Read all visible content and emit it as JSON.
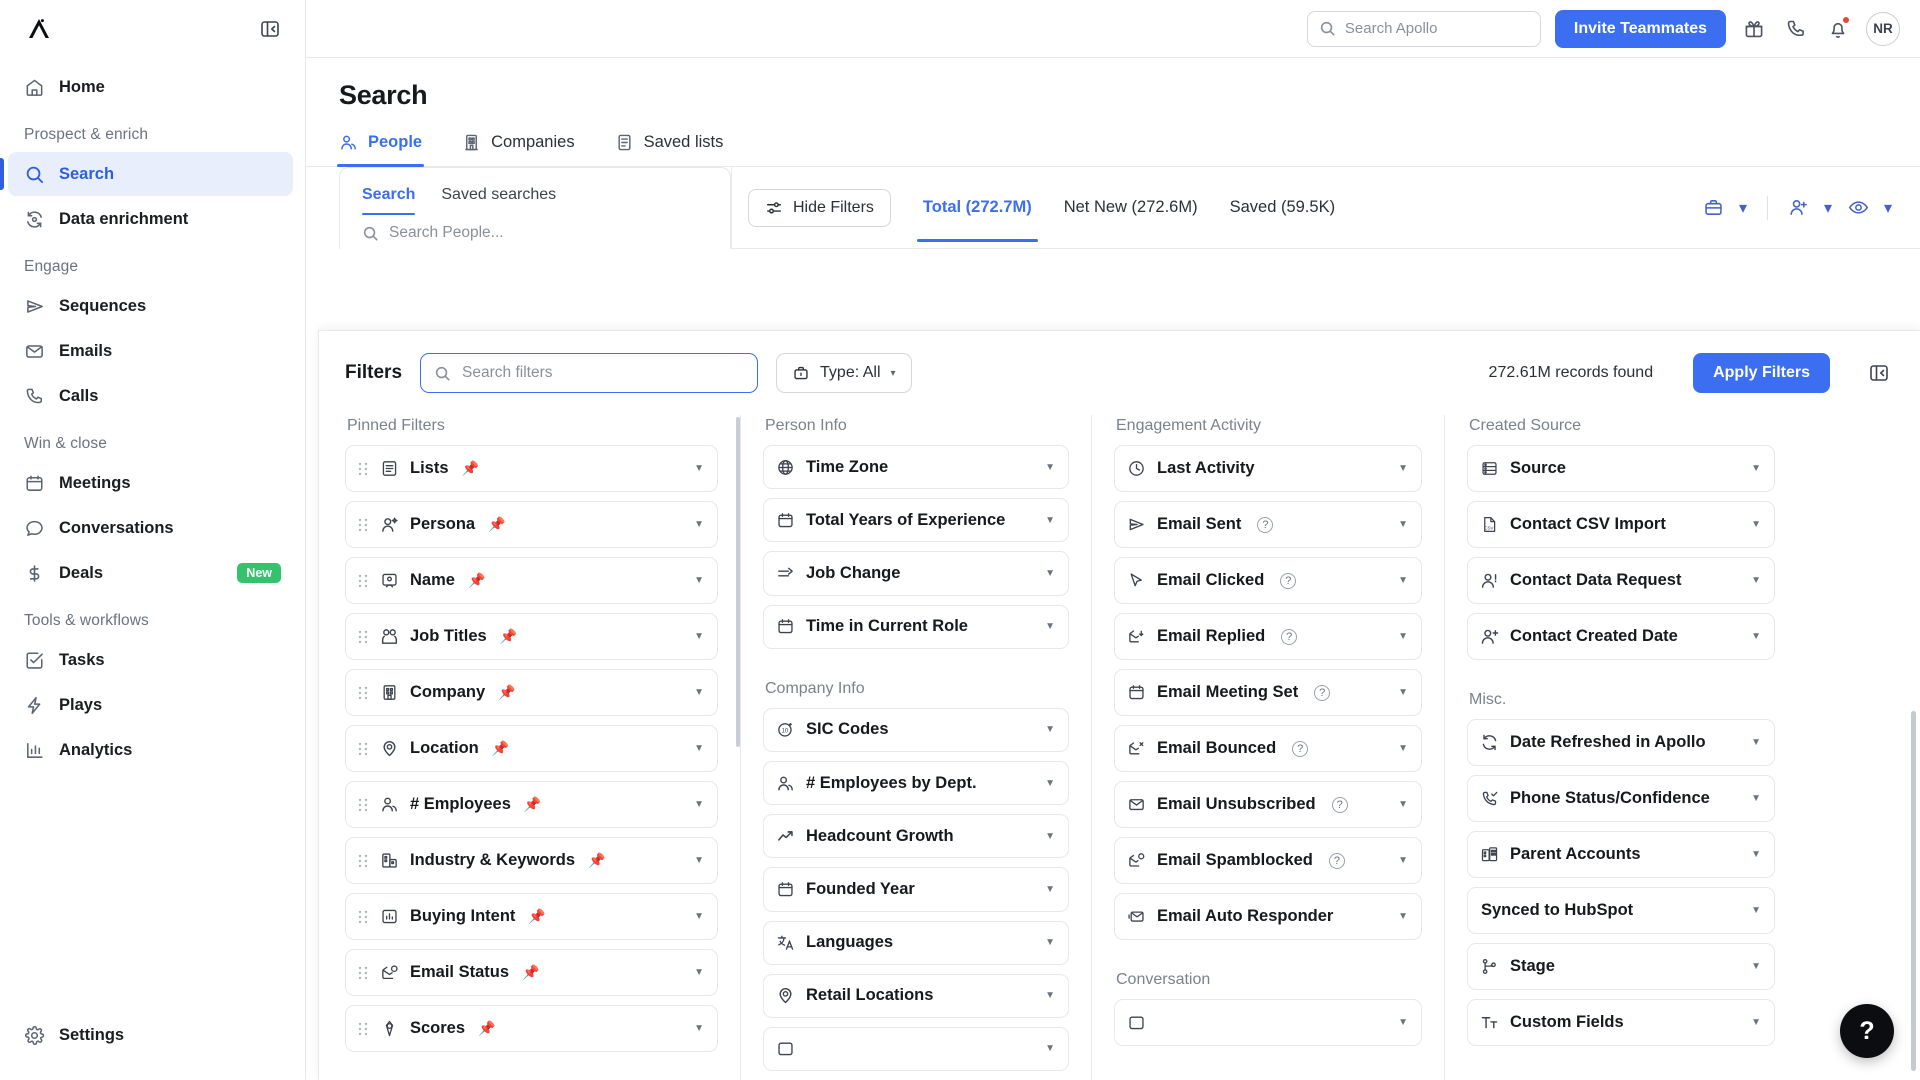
{
  "app": {
    "logo_name": "apollo-logo",
    "user_initials": "NR"
  },
  "topbar": {
    "search_placeholder": "Search Apollo",
    "search_value": "",
    "invite_label": "Invite Teammates",
    "icons": [
      "gift-icon",
      "phone-icon",
      "bell-icon"
    ]
  },
  "sidebar": {
    "home": {
      "label": "Home",
      "icon": "home-icon"
    },
    "groups": [
      {
        "label": "Prospect & enrich",
        "items": [
          {
            "label": "Search",
            "icon": "search-icon",
            "active": true
          },
          {
            "label": "Data enrichment",
            "icon": "refresh-data-icon",
            "active": false
          }
        ]
      },
      {
        "label": "Engage",
        "items": [
          {
            "label": "Sequences",
            "icon": "send-icon",
            "active": false
          },
          {
            "label": "Emails",
            "icon": "envelope-icon",
            "active": false
          },
          {
            "label": "Calls",
            "icon": "phone-icon",
            "active": false
          }
        ]
      },
      {
        "label": "Win & close",
        "items": [
          {
            "label": "Meetings",
            "icon": "calendar-icon",
            "active": false
          },
          {
            "label": "Conversations",
            "icon": "chat-bubble-icon",
            "active": false
          },
          {
            "label": "Deals",
            "icon": "dollar-icon",
            "active": false,
            "badge": "New"
          }
        ]
      },
      {
        "label": "Tools & workflows",
        "items": [
          {
            "label": "Tasks",
            "icon": "checkbox-icon",
            "active": false
          },
          {
            "label": "Plays",
            "icon": "lightning-icon",
            "active": false
          },
          {
            "label": "Analytics",
            "icon": "bar-chart-icon",
            "active": false
          }
        ]
      }
    ],
    "settings": {
      "label": "Settings",
      "icon": "gear-icon"
    }
  },
  "page": {
    "title": "Search",
    "tabs": [
      {
        "label": "People",
        "icon": "people-icon",
        "active": true
      },
      {
        "label": "Companies",
        "icon": "building-icon",
        "active": false
      },
      {
        "label": "Saved lists",
        "icon": "list-icon",
        "active": false
      }
    ]
  },
  "search_panel": {
    "tabs": [
      {
        "label": "Search",
        "active": true
      },
      {
        "label": "Saved searches",
        "active": false
      }
    ],
    "input_placeholder": "Search People...",
    "input_value": ""
  },
  "filter_bar": {
    "hide_filters_label": "Hide Filters",
    "count_tabs": [
      {
        "label": "Total (272.7M)",
        "active": true
      },
      {
        "label": "Net New (272.6M)",
        "active": false
      },
      {
        "label": "Saved (59.5K)",
        "active": false
      }
    ],
    "action_icons": [
      "briefcase-icon",
      "add-person-icon",
      "eye-icon"
    ]
  },
  "filters": {
    "title": "Filters",
    "search_placeholder": "Search filters",
    "search_value": "",
    "type_label": "Type: All",
    "records_found": "272.61M records found",
    "apply_label": "Apply Filters",
    "collapse_icon": "collapse-panel-icon",
    "columns": [
      {
        "id": "pinned",
        "groups": [
          {
            "label": "Pinned Filters",
            "items": [
              {
                "label": "Lists",
                "icon": "list-icon",
                "pinned": true,
                "drag": true
              },
              {
                "label": "Persona",
                "icon": "persona-icon",
                "pinned": true,
                "drag": true
              },
              {
                "label": "Name",
                "icon": "name-card-icon",
                "pinned": true,
                "drag": true
              },
              {
                "label": "Job Titles",
                "icon": "job-title-icon",
                "pinned": true,
                "drag": true
              },
              {
                "label": "Company",
                "icon": "building-icon",
                "pinned": true,
                "drag": true
              },
              {
                "label": "Location",
                "icon": "location-pin-icon",
                "pinned": true,
                "drag": true
              },
              {
                "label": "# Employees",
                "icon": "people-icon",
                "pinned": true,
                "drag": true
              },
              {
                "label": "Industry & Keywords",
                "icon": "industry-icon",
                "pinned": true,
                "drag": true
              },
              {
                "label": "Buying Intent",
                "icon": "bar-chart-icon",
                "pinned": true,
                "drag": true
              },
              {
                "label": "Email Status",
                "icon": "email-status-icon",
                "pinned": true,
                "drag": true
              },
              {
                "label": "Scores",
                "icon": "score-icon",
                "pinned": true,
                "drag": true
              }
            ]
          }
        ]
      },
      {
        "id": "person-company",
        "groups": [
          {
            "label": "Person Info",
            "items": [
              {
                "label": "Time Zone",
                "icon": "globe-icon"
              },
              {
                "label": "Total Years of Experience",
                "icon": "calendar-icon"
              },
              {
                "label": "Job Change",
                "icon": "arrow-change-icon"
              },
              {
                "label": "Time in Current Role",
                "icon": "calendar-icon"
              }
            ]
          },
          {
            "label": "Company Info",
            "items": [
              {
                "label": "SIC Codes",
                "icon": "sic-code-icon"
              },
              {
                "label": "# Employees by Dept.",
                "icon": "people-icon"
              },
              {
                "label": "Headcount Growth",
                "icon": "trend-up-icon"
              },
              {
                "label": "Founded Year",
                "icon": "calendar-icon"
              },
              {
                "label": "Languages",
                "icon": "translate-icon"
              },
              {
                "label": "Retail Locations",
                "icon": "location-pin-icon"
              }
            ]
          }
        ]
      },
      {
        "id": "engagement",
        "groups": [
          {
            "label": "Engagement Activity",
            "items": [
              {
                "label": "Last Activity",
                "icon": "clock-icon"
              },
              {
                "label": "Email Sent",
                "icon": "send-icon",
                "help": true
              },
              {
                "label": "Email Clicked",
                "icon": "cursor-icon",
                "help": true
              },
              {
                "label": "Email Replied",
                "icon": "email-reply-icon",
                "help": true
              },
              {
                "label": "Email Meeting Set",
                "icon": "calendar-icon",
                "help": true
              },
              {
                "label": "Email Bounced",
                "icon": "email-bounced-icon",
                "help": true
              },
              {
                "label": "Email Unsubscribed",
                "icon": "envelope-icon",
                "help": true
              },
              {
                "label": "Email Spamblocked",
                "icon": "email-spam-icon",
                "help": true
              },
              {
                "label": "Email Auto Responder",
                "icon": "email-auto-icon"
              }
            ]
          },
          {
            "label": "Conversation",
            "items": []
          }
        ]
      },
      {
        "id": "created-misc",
        "groups": [
          {
            "label": "Created Source",
            "items": [
              {
                "label": "Source",
                "icon": "database-icon"
              },
              {
                "label": "Contact CSV Import",
                "icon": "csv-file-icon"
              },
              {
                "label": "Contact Data Request",
                "icon": "person-request-icon"
              },
              {
                "label": "Contact Created Date",
                "icon": "add-person-icon"
              }
            ]
          },
          {
            "label": "Misc.",
            "items": [
              {
                "label": "Date Refreshed in Apollo",
                "icon": "refresh-icon"
              },
              {
                "label": "Phone Status/Confidence",
                "icon": "phone-check-icon"
              },
              {
                "label": "Parent Accounts",
                "icon": "parent-building-icon"
              },
              {
                "label": "Synced to HubSpot",
                "icon": "none"
              },
              {
                "label": "Stage",
                "icon": "branch-icon"
              },
              {
                "label": "Custom Fields",
                "icon": "text-format-icon"
              }
            ]
          }
        ]
      }
    ]
  },
  "help": {
    "label": "?"
  },
  "colors": {
    "accent": "#3b6ef0",
    "accent_light": "#e8eefc",
    "pin_yellow": "#f2c037",
    "badge_green": "#34c26d",
    "text": "#16191d",
    "muted": "#7a828d",
    "border": "#e6e8eb"
  }
}
